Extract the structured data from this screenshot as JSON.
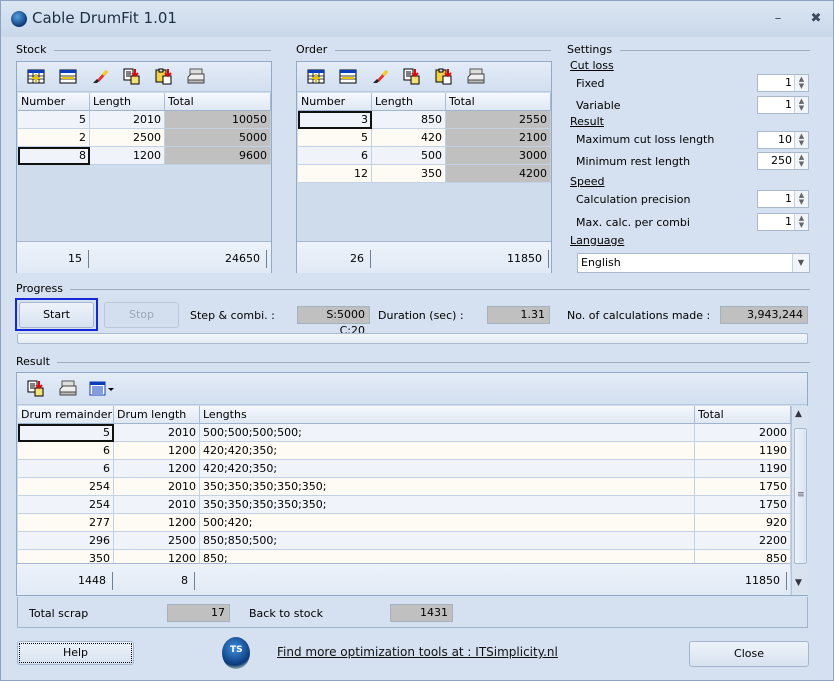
{
  "window": {
    "title": "Cable DrumFit 1.01",
    "minimize_icon": "minimize-icon",
    "close_icon": "close-icon"
  },
  "stock": {
    "label": "Stock",
    "toolbar_icons": [
      "insert-row-icon",
      "delete-row-icon",
      "clear-icon",
      "import-icon",
      "paste-icon",
      "print-icon"
    ],
    "columns": [
      "Number",
      "Length",
      "Total"
    ],
    "rows": [
      {
        "number": "5",
        "length": "2010",
        "total": "10050"
      },
      {
        "number": "2",
        "length": "2500",
        "total": "5000"
      },
      {
        "number": "8",
        "length": "1200",
        "total": "9600"
      }
    ],
    "footer": {
      "number_sum": "15",
      "total_sum": "24650"
    }
  },
  "order": {
    "label": "Order",
    "toolbar_icons": [
      "insert-row-icon",
      "delete-row-icon",
      "clear-icon",
      "import-icon",
      "paste-icon",
      "print-icon"
    ],
    "columns": [
      "Number",
      "Length",
      "Total"
    ],
    "rows": [
      {
        "number": "3",
        "length": "850",
        "total": "2550"
      },
      {
        "number": "5",
        "length": "420",
        "total": "2100"
      },
      {
        "number": "6",
        "length": "500",
        "total": "3000"
      },
      {
        "number": "12",
        "length": "350",
        "total": "4200"
      }
    ],
    "footer": {
      "number_sum": "26",
      "total_sum": "11850"
    }
  },
  "settings": {
    "label": "Settings",
    "cut_loss": {
      "heading": "Cut loss",
      "fixed_label": "Fixed",
      "fixed_value": "1",
      "variable_label": "Variable",
      "variable_value": "1"
    },
    "result": {
      "heading": "Result",
      "max_cut_loss_label": "Maximum cut loss length",
      "max_cut_loss_value": "10",
      "min_rest_label": "Minimum rest length",
      "min_rest_value": "250"
    },
    "speed": {
      "heading": "Speed",
      "precision_label": "Calculation precision",
      "precision_value": "1",
      "max_calc_label": "Max. calc. per combi",
      "max_calc_value": "1"
    },
    "language": {
      "heading": "Language",
      "selected": "English"
    }
  },
  "progress": {
    "label": "Progress",
    "start_label": "Start",
    "stop_label": "Stop",
    "step_label": "Step & combi. :",
    "step_value": "S:5000 C:20",
    "duration_label": "Duration (sec) :",
    "duration_value": "1.31",
    "calcs_label": "No. of calculations made :",
    "calcs_value": "3,943,244",
    "bar_fraction": 0
  },
  "result": {
    "label": "Result",
    "toolbar_icons": [
      "export-icon",
      "print-icon",
      "columns-menu-icon"
    ],
    "columns": [
      "Drum remainder",
      "Drum length",
      "Lengths",
      "Total"
    ],
    "rows": [
      {
        "remainder": "5",
        "drum_length": "2010",
        "lengths": "500;500;500;500;",
        "total": "2000"
      },
      {
        "remainder": "6",
        "drum_length": "1200",
        "lengths": "420;420;350;",
        "total": "1190"
      },
      {
        "remainder": "6",
        "drum_length": "1200",
        "lengths": "420;420;350;",
        "total": "1190"
      },
      {
        "remainder": "254",
        "drum_length": "2010",
        "lengths": "350;350;350;350;350;",
        "total": "1750"
      },
      {
        "remainder": "254",
        "drum_length": "2010",
        "lengths": "350;350;350;350;350;",
        "total": "1750"
      },
      {
        "remainder": "277",
        "drum_length": "1200",
        "lengths": "500;420;",
        "total": "920"
      },
      {
        "remainder": "296",
        "drum_length": "2500",
        "lengths": "850;850;500;",
        "total": "2200"
      },
      {
        "remainder": "350",
        "drum_length": "1200",
        "lengths": "850;",
        "total": "850"
      }
    ],
    "footer": {
      "remainder_sum": "1448",
      "drum_count": "8",
      "total_sum": "11850"
    },
    "total_scrap_label": "Total scrap",
    "total_scrap_value": "17",
    "back_to_stock_label": "Back to stock",
    "back_to_stock_value": "1431"
  },
  "bottom": {
    "help_label": "Help",
    "link_text": "Find more optimization tools at : ITSimplicity.nl",
    "close_label": "Close"
  }
}
